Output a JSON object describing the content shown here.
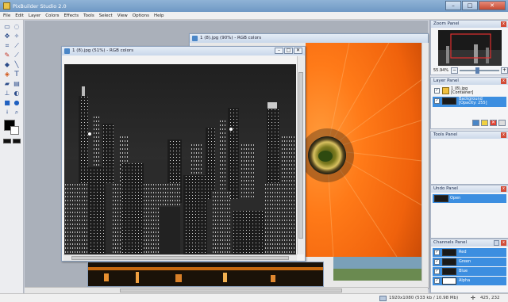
{
  "app": {
    "title": "PixBuilder Studio 2.0",
    "win_min": "–",
    "win_max": "□",
    "win_close": "✕"
  },
  "menu": [
    "File",
    "Edit",
    "Layer",
    "Colors",
    "Effects",
    "Tools",
    "Select",
    "View",
    "Options",
    "Help"
  ],
  "documents": {
    "front": {
      "title": "1 (8).jpg (51%) - RGB colors",
      "btn_min": "–",
      "btn_max": "□",
      "btn_close": "✕"
    },
    "back": {
      "title": "1 (8).jpg (90%) - RGB colors"
    }
  },
  "panels": {
    "zoom": {
      "title": "Zoom Panel",
      "value": "55.94%",
      "minus": "−",
      "plus": "+"
    },
    "layers": {
      "title": "Layer Panel",
      "items": [
        {
          "name": "1 (8).jpg",
          "sub": "[Container]"
        },
        {
          "name": "Background",
          "sub": "[Opacity: 255]"
        }
      ]
    },
    "tools": {
      "title": "Tools Panel"
    },
    "undo": {
      "title": "Undo Panel",
      "items": [
        "Open"
      ]
    },
    "channels": {
      "title": "Channels Panel",
      "items": [
        "Red",
        "Green",
        "Blue",
        "Alpha"
      ]
    },
    "close_glyph": "x"
  },
  "status": {
    "dimensions": "1920x1080 (533 kb / 10.98 Mb)",
    "coords": "425, 232"
  },
  "colors": {
    "accent": "#3c8ee0",
    "foreground": "#000000",
    "background": "#ffffff"
  }
}
